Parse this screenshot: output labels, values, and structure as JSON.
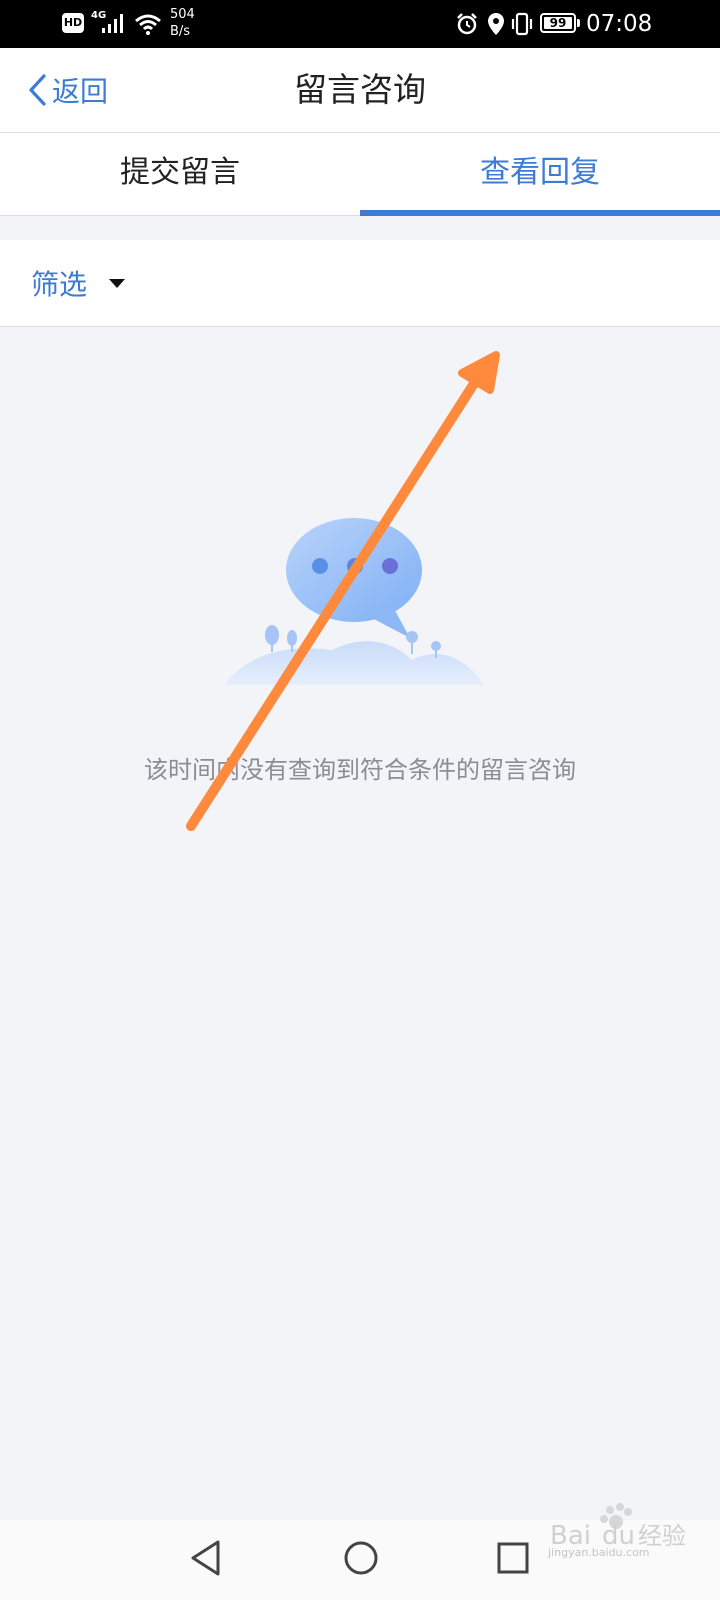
{
  "status_bar": {
    "hd_badge": "HD",
    "network": "4G",
    "speed_value": "504",
    "speed_unit": "B/s",
    "battery": "99",
    "time": "07:08"
  },
  "header": {
    "back_label": "返回",
    "title": "留言咨询"
  },
  "tabs": [
    {
      "label": "提交留言",
      "active": false
    },
    {
      "label": "查看回复",
      "active": true
    }
  ],
  "filter": {
    "label": "筛选"
  },
  "empty_state": {
    "message": "该时间内没有查询到符合条件的留言咨询"
  },
  "watermark": {
    "brand": "Bai du 经验",
    "url": "jingyan.baidu.com"
  },
  "colors": {
    "accent": "#3d7bd4",
    "background": "#f3f4f8",
    "annotation": "#ff8a3d"
  },
  "icons": [
    "back-chevron-icon",
    "dropdown-caret-icon",
    "chat-bubble-illustration",
    "nav-back-icon",
    "nav-home-icon",
    "nav-recent-icon"
  ]
}
